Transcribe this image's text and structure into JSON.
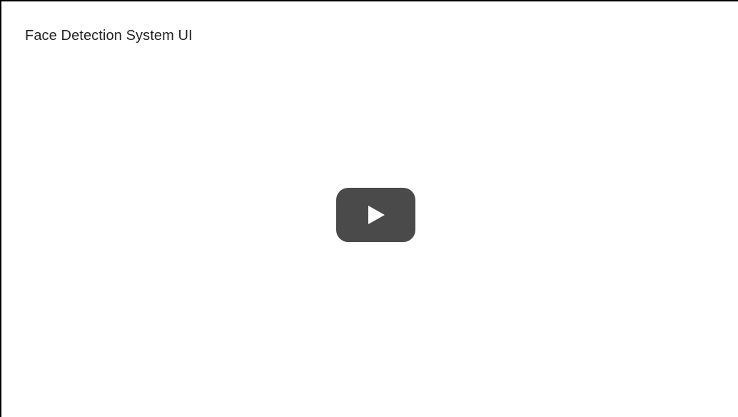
{
  "video": {
    "title": "Face Detection System UI",
    "play_icon": "play-icon"
  },
  "colors": {
    "background": "#ffffff",
    "border": "#000000",
    "title_text": "#222222",
    "play_button_bg": "#4a4a4a",
    "play_triangle": "#ffffff"
  }
}
